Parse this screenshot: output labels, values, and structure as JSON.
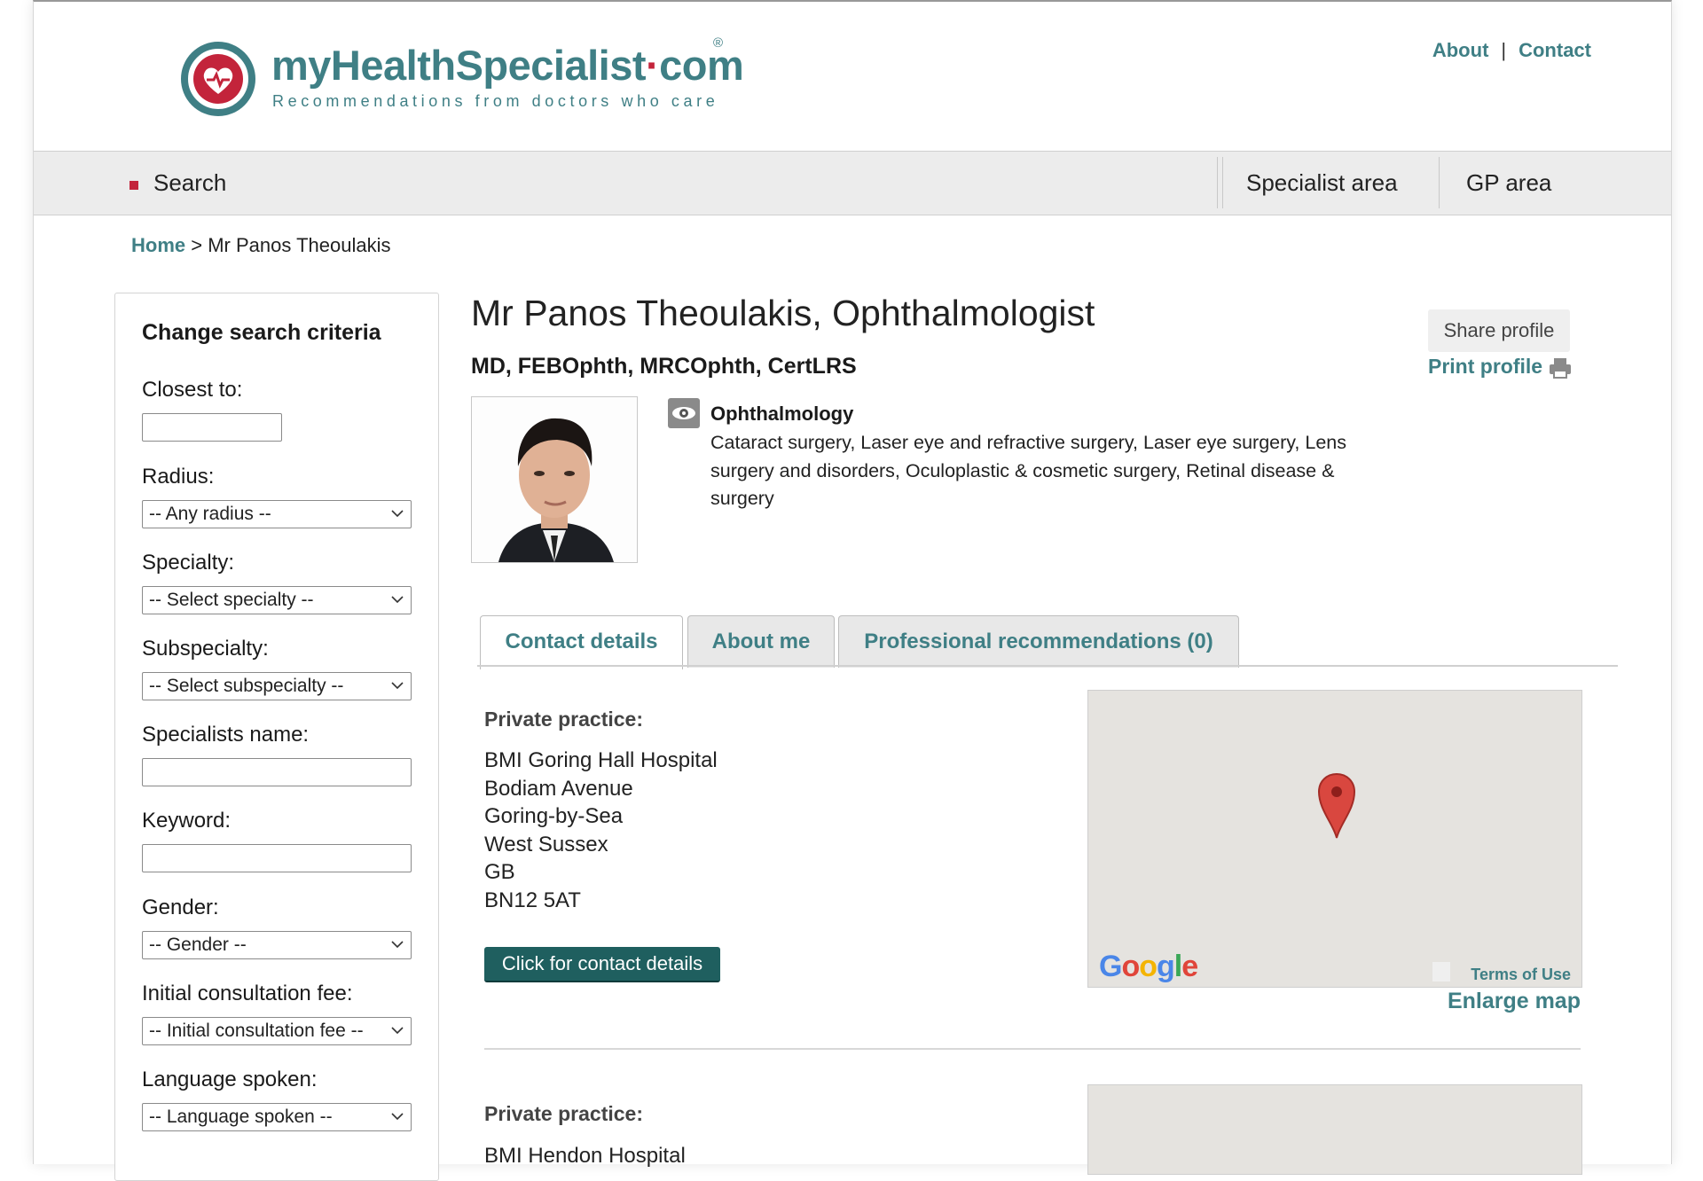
{
  "brand": {
    "name_part1": "myHealthSpecialist",
    "name_dot": "·",
    "name_part2": "com",
    "registered": "®",
    "tagline": "Recommendations from doctors who care"
  },
  "top_links": {
    "about": "About",
    "separator": "|",
    "contact": "Contact"
  },
  "nav": {
    "search": "Search",
    "specialist_area": "Specialist area",
    "gp_area": "GP area"
  },
  "breadcrumb": {
    "home": "Home",
    "separator": ">",
    "current": "Mr Panos Theoulakis"
  },
  "sidebar": {
    "title": "Change search criteria",
    "closest_label": "Closest to:",
    "radius_label": "Radius:",
    "radius_value": "-- Any radius --",
    "specialty_label": "Specialty:",
    "specialty_value": "-- Select specialty --",
    "subspecialty_label": "Subspecialty:",
    "subspecialty_value": "-- Select subspecialty --",
    "name_label": "Specialists name:",
    "keyword_label": "Keyword:",
    "gender_label": "Gender:",
    "gender_value": "-- Gender --",
    "fee_label": "Initial consultation fee:",
    "fee_value": "-- Initial consultation fee --",
    "language_label": "Language spoken:",
    "language_value": "-- Language spoken --"
  },
  "profile": {
    "name": "Mr Panos Theoulakis, Ophthalmologist",
    "credentials": "MD, FEBOphth, MRCOphth, CertLRS",
    "share_label": "Share profile",
    "print_label": "Print profile",
    "specialty": "Ophthalmology",
    "specialty_desc": "Cataract surgery, Laser eye and refractive surgery, Laser eye surgery, Lens surgery and disorders, Oculoplastic & cosmetic surgery, Retinal disease & surgery"
  },
  "tabs": [
    {
      "label": "Contact details",
      "active": true
    },
    {
      "label": "About me",
      "active": false
    },
    {
      "label": "Professional recommendations (0)",
      "active": false
    }
  ],
  "practices": [
    {
      "label": "Private practice:",
      "lines": [
        "BMI Goring Hall Hospital",
        "Bodiam Avenue",
        "Goring-by-Sea",
        "West Sussex",
        "GB",
        "BN12 5AT"
      ],
      "button": "Click for contact details",
      "map_logo": "Google",
      "map_terms": "Terms of Use",
      "enlarge": "Enlarge map"
    },
    {
      "label": "Private practice:",
      "lines": [
        "BMI Hendon Hospital"
      ]
    }
  ],
  "colors": {
    "brand_teal": "#3f7f85",
    "accent_red": "#c3243b",
    "button_dark_teal": "#1f5f5f"
  }
}
